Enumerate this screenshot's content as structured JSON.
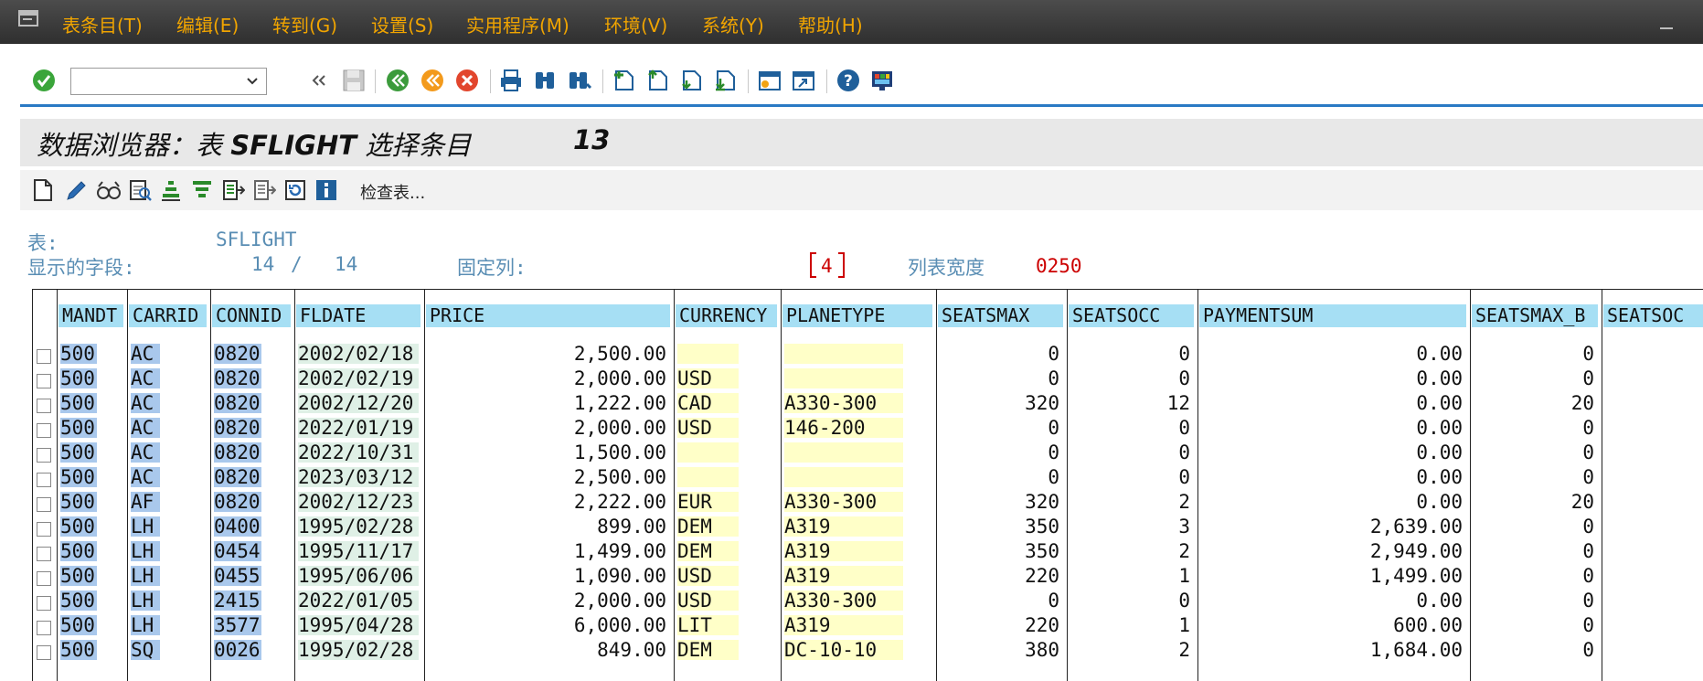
{
  "menu": [
    {
      "label": "表条目(T)"
    },
    {
      "label": "编辑(E)"
    },
    {
      "label": "转到(G)"
    },
    {
      "label": "设置(S)"
    },
    {
      "label": "实用程序(M)"
    },
    {
      "label": "环境(V)"
    },
    {
      "label": "系统(Y)"
    },
    {
      "label": "帮助(H)"
    }
  ],
  "toolbar": {
    "command_value": "",
    "icons": [
      "enter-icon",
      "back-double-icon",
      "save-icon",
      "back-icon",
      "exit-icon",
      "cancel-icon",
      "print-icon",
      "find-icon",
      "find-next-icon",
      "first-page-icon",
      "previous-page-icon",
      "next-page-icon",
      "last-page-icon",
      "create-session-icon",
      "shortcut-icon",
      "help-icon",
      "customize-layout-icon"
    ]
  },
  "title": {
    "prefix": "数据浏览器：表 ",
    "table": "SFLIGHT",
    "suffix": " 选择条目",
    "count": "13"
  },
  "app_toolbar": {
    "icons": [
      "new-icon",
      "edit-icon",
      "display-icon",
      "details-icon",
      "sort-ascending-icon",
      "filter-icon",
      "layout-icon",
      "change-layout-icon",
      "refresh-icon",
      "info-icon"
    ],
    "check_label": "检查表..."
  },
  "info": {
    "table_label": "表:",
    "table_value": "SFLIGHT",
    "fields_label": "显示的字段:",
    "fields_shown": "14",
    "fields_sep": "/",
    "fields_total": "14",
    "fixed_label": "固定列:",
    "fixed_value": "4",
    "width_label": "列表宽度",
    "width_value": "0250"
  },
  "columns": [
    "MANDT",
    "CARRID",
    "CONNID",
    "FLDATE",
    "PRICE",
    "CURRENCY",
    "PLANETYPE",
    "SEATSMAX",
    "SEATSOCC",
    "PAYMENTSUM",
    "SEATSMAX_B",
    "SEATSOC"
  ],
  "rows": [
    [
      "500",
      "AC",
      "0820",
      "2002/02/18",
      "2,500.00",
      "",
      "",
      "0",
      "0",
      "0.00",
      "0"
    ],
    [
      "500",
      "AC",
      "0820",
      "2002/02/19",
      "2,000.00",
      "USD",
      "",
      "0",
      "0",
      "0.00",
      "0"
    ],
    [
      "500",
      "AC",
      "0820",
      "2002/12/20",
      "1,222.00",
      "CAD",
      "A330-300",
      "320",
      "12",
      "0.00",
      "20"
    ],
    [
      "500",
      "AC",
      "0820",
      "2022/01/19",
      "2,000.00",
      "USD",
      "146-200",
      "0",
      "0",
      "0.00",
      "0"
    ],
    [
      "500",
      "AC",
      "0820",
      "2022/10/31",
      "1,500.00",
      "",
      "",
      "0",
      "0",
      "0.00",
      "0"
    ],
    [
      "500",
      "AC",
      "0820",
      "2023/03/12",
      "2,500.00",
      "",
      "",
      "0",
      "0",
      "0.00",
      "0"
    ],
    [
      "500",
      "AF",
      "0820",
      "2002/12/23",
      "2,222.00",
      "EUR",
      "A330-300",
      "320",
      "2",
      "0.00",
      "20"
    ],
    [
      "500",
      "LH",
      "0400",
      "1995/02/28",
      "899.00",
      "DEM",
      "A319",
      "350",
      "3",
      "2,639.00",
      "0"
    ],
    [
      "500",
      "LH",
      "0454",
      "1995/11/17",
      "1,499.00",
      "DEM",
      "A319",
      "350",
      "2",
      "2,949.00",
      "0"
    ],
    [
      "500",
      "LH",
      "0455",
      "1995/06/06",
      "1,090.00",
      "USD",
      "A319",
      "220",
      "1",
      "1,499.00",
      "0"
    ],
    [
      "500",
      "LH",
      "2415",
      "2022/01/05",
      "2,000.00",
      "USD",
      "A330-300",
      "0",
      "0",
      "0.00",
      "0"
    ],
    [
      "500",
      "LH",
      "3577",
      "1995/04/28",
      "6,000.00",
      "LIT",
      "A319",
      "220",
      "1",
      "600.00",
      "0"
    ],
    [
      "500",
      "SQ",
      "0026",
      "1995/02/28",
      "849.00",
      "DEM",
      "DC-10-10",
      "380",
      "2",
      "1,684.00",
      "0"
    ]
  ]
}
